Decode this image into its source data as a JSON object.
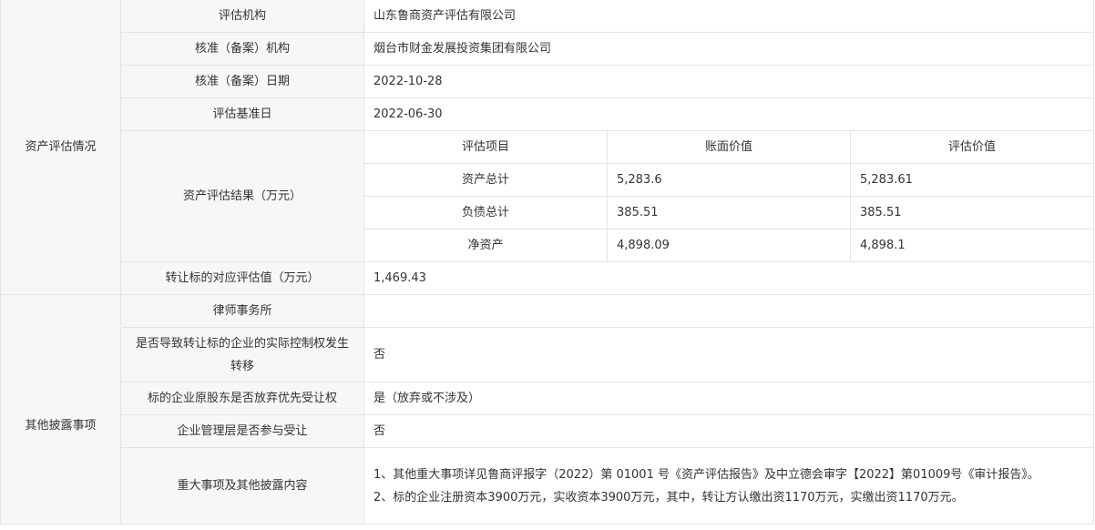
{
  "section_asset": "资产评估情况",
  "section_other": "其他披露事项",
  "rows": {
    "appraiser": {
      "label": "评估机构",
      "value": "山东鲁商资产评估有限公司"
    },
    "approver": {
      "label": "核准（备案）机构",
      "value": "烟台市财金发展投资集团有限公司"
    },
    "approve_date": {
      "label": "核准（备案）日期",
      "value": "2022-10-28"
    },
    "base_date": {
      "label": "评估基准日",
      "value": "2022-06-30"
    },
    "result": {
      "label": "资产评估结果（万元）",
      "headers": [
        "评估项目",
        "账面价值",
        "评估价值"
      ],
      "items": [
        {
          "name": "资产总计",
          "book": "5,283.6",
          "appraised": "5,283.61"
        },
        {
          "name": "负债总计",
          "book": "385.51",
          "appraised": "385.51"
        },
        {
          "name": "净资产",
          "book": "4,898.09",
          "appraised": "4,898.1"
        }
      ]
    },
    "target_value": {
      "label": "转让标的对应评估值（万元）",
      "value": "1,469.43"
    },
    "law_firm": {
      "label": "律师事务所",
      "value": ""
    },
    "control_change": {
      "label": "是否导致转让标的企业的实际控制权发生转移",
      "value": "否"
    },
    "preemption": {
      "label": "标的企业原股东是否放弃优先受让权",
      "value": "是（放弃或不涉及）"
    },
    "management": {
      "label": "企业管理层是否参与受让",
      "value": "否"
    },
    "major": {
      "label": "重大事项及其他披露内容",
      "line1": "1、其他重大事项详见鲁商评报字（2022）第 01001 号《资产评估报告》及中立德会审字【2022】第01009号《审计报告》。",
      "line2": "2、标的企业注册资本3900万元，实收资本3900万元，其中，转让方认缴出资1170万元，实缴出资1170万元。"
    }
  }
}
